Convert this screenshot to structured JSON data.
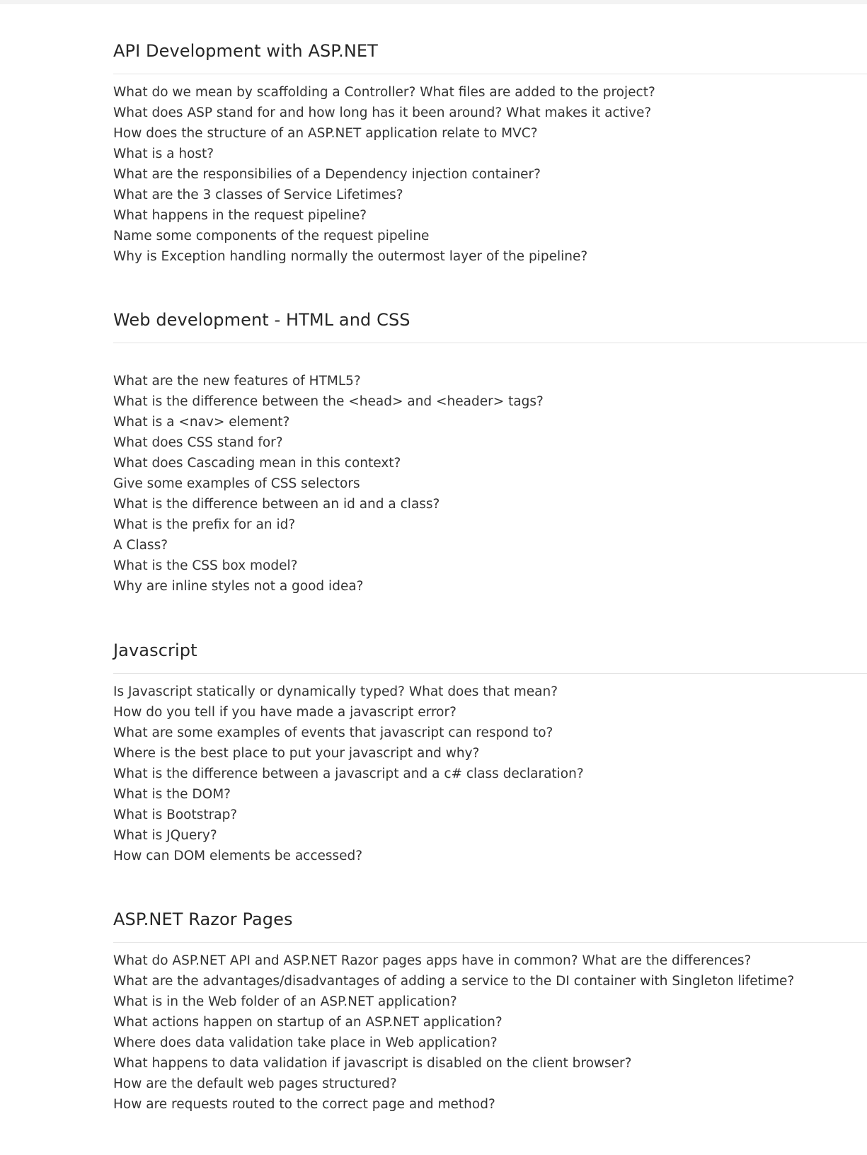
{
  "sections": [
    {
      "title": "API Development with ASP.NET",
      "questions": [
        "What do we mean by scaffolding a Controller?  What files are added to the project?",
        "What does ASP stand for and how long has it been around?  What makes it active?",
        "How does the structure of an ASP.NET application relate to MVC?",
        "What is a host?",
        "What are the responsibilies of a Dependency injection container?",
        "What are the 3 classes of Service Lifetimes?",
        "What happens in the request pipeline?",
        "Name some components of the request pipeline",
        "Why is Exception handling normally the outermost layer of the pipeline?"
      ]
    },
    {
      "title": "Web development - HTML and CSS",
      "questions": [
        "What are the new features of HTML5?",
        "What is the difference between the <head> and <header> tags?",
        "What is a <nav> element?",
        "What does CSS stand for?",
        "What does Cascading mean in this context?",
        "Give some examples of CSS selectors",
        "What is the difference between an id and a class?",
        "What is the prefix for an id?",
        "A Class?",
        "What is the CSS box model?",
        "Why are inline styles not a good idea?"
      ]
    },
    {
      "title": "Javascript",
      "questions": [
        "Is Javascript statically or dynamically typed?  What does that mean?",
        "How do you tell if you have made a javascript error?",
        "What are some examples of events that javascript can respond to?",
        "Where is the best place to put your javascript and why?",
        "What is the difference between a javascript and a c# class declaration?",
        "What is the DOM?",
        "What is Bootstrap?",
        "What is JQuery?",
        "How can DOM elements be accessed?"
      ]
    },
    {
      "title": "ASP.NET Razor Pages",
      "questions": [
        "What do ASP.NET API and ASP.NET Razor pages apps have in common?  What are the differences?",
        "What are the advantages/disadvantages of adding a service to the DI container with Singleton lifetime?",
        "What is in the Web folder of an ASP.NET application?",
        "What actions happen on startup of an ASP.NET application?",
        "Where does data validation take place in Web application?",
        "What happens to data validation if javascript is disabled on the client browser?",
        "How are the default web pages structured?",
        "How are requests routed to the correct page and method?"
      ]
    }
  ]
}
